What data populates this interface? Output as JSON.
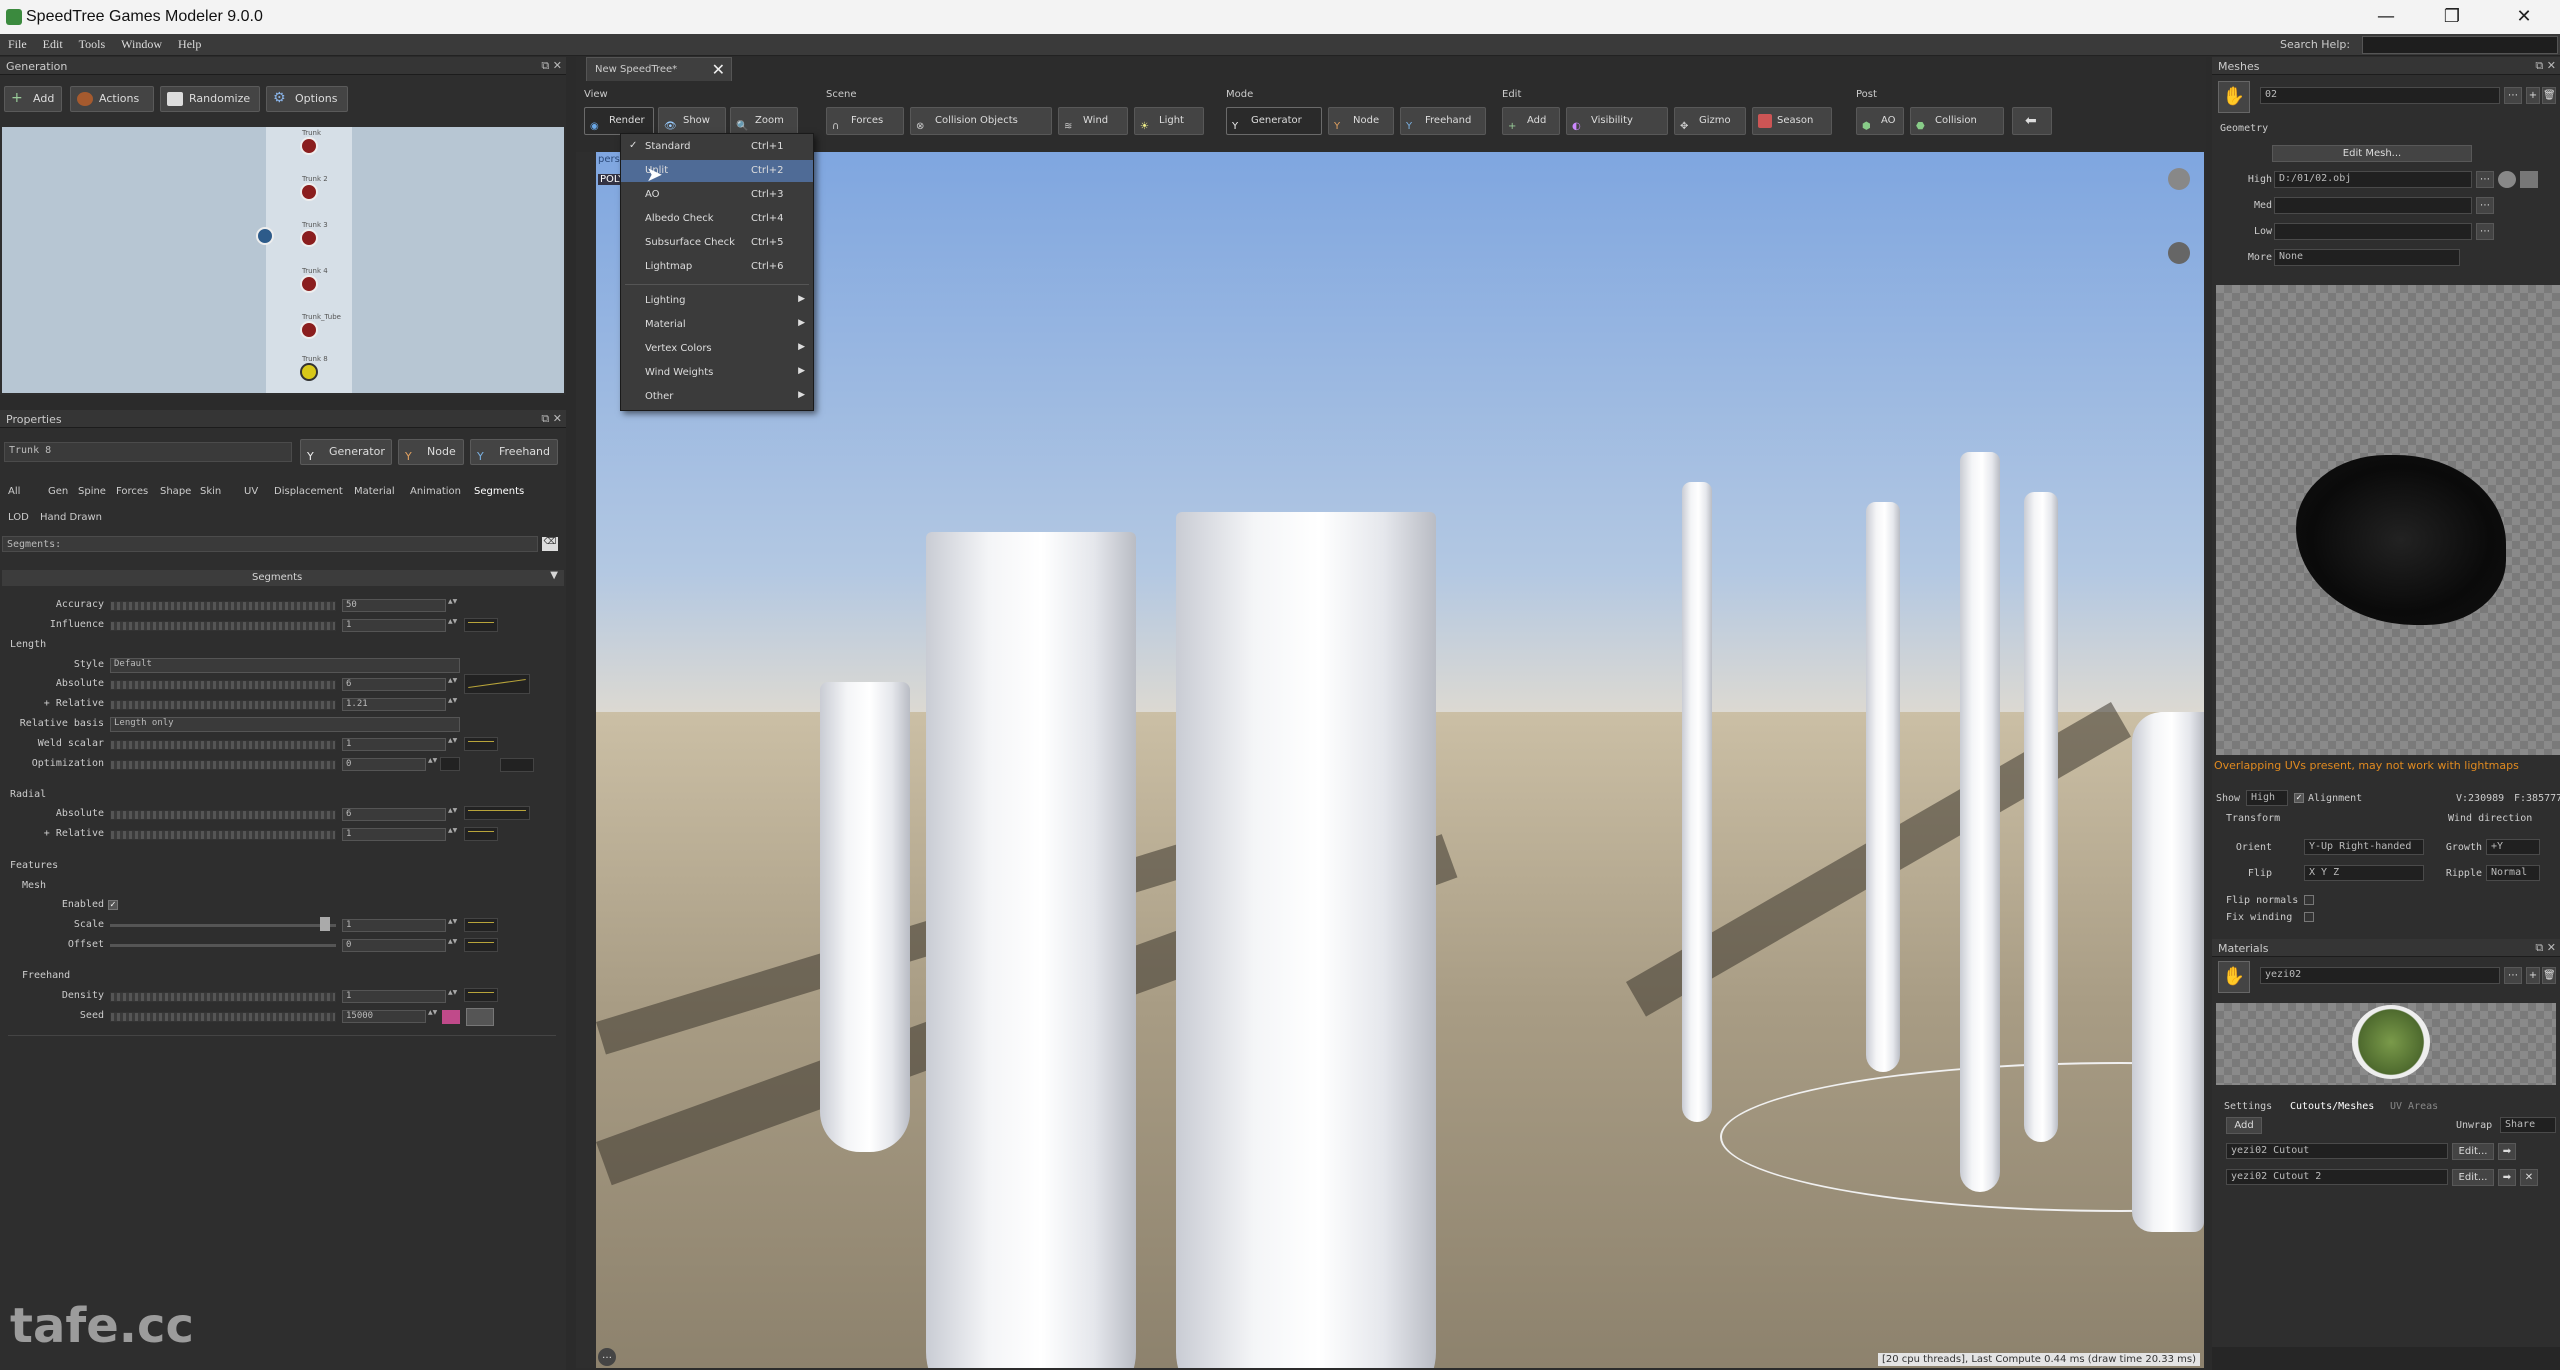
{
  "window": {
    "title": "SpeedTree Games Modeler 9.0.0",
    "minimize": "—",
    "maximize": "❐",
    "close": "✕"
  },
  "menu": {
    "items": [
      "File",
      "Edit",
      "Tools",
      "Window",
      "Help"
    ],
    "search_label": "Search Help:"
  },
  "generation": {
    "title": "Generation",
    "buttons": {
      "add": "Add",
      "actions": "Actions",
      "randomize": "Randomize",
      "options": "Options"
    },
    "nodes": [
      "Trunk",
      "Trunk 2",
      "Trunk 3",
      "Trunk 4",
      "Trunk_Tube",
      "Trunk 8"
    ]
  },
  "properties": {
    "title": "Properties",
    "name_value": "Trunk 8",
    "mode_buttons": {
      "generator": "Generator",
      "node": "Node",
      "freehand": "Freehand"
    },
    "tabs_row1": [
      "All",
      "Gen",
      "Spine",
      "Forces",
      "Shape",
      "Skin",
      "UV",
      "Displacement",
      "Material",
      "Animation",
      "Segments"
    ],
    "tabs_row2": [
      "LOD",
      "Hand Drawn"
    ],
    "filter_label": "Segments:",
    "section_title": "Segments",
    "rows": {
      "accuracy": {
        "label": "Accuracy",
        "value": "50"
      },
      "influence": {
        "label": "Influence",
        "value": "1"
      },
      "length_hdr": "Length",
      "style": {
        "label": "Style",
        "value": "Default"
      },
      "absolute": {
        "label": "Absolute",
        "value": "6"
      },
      "relative": {
        "label": "+ Relative",
        "value": "1.21"
      },
      "rel_basis": {
        "label": "Relative basis",
        "value": "Length only"
      },
      "weld": {
        "label": "Weld scalar",
        "value": "1"
      },
      "optimization": {
        "label": "Optimization",
        "value": "0"
      },
      "radial_hdr": "Radial",
      "r_absolute": {
        "label": "Absolute",
        "value": "6"
      },
      "r_relative": {
        "label": "+ Relative",
        "value": "1"
      },
      "features_hdr": "Features",
      "mesh_hdr": "Mesh",
      "enabled": {
        "label": "Enabled"
      },
      "scale": {
        "label": "Scale",
        "value": "1"
      },
      "offset": {
        "label": "Offset",
        "value": "0"
      },
      "freehand_hdr": "Freehand",
      "density": {
        "label": "Density",
        "value": "1"
      },
      "seed": {
        "label": "Seed",
        "value": "15000"
      }
    }
  },
  "center": {
    "doc_tab": "New SpeedTree*",
    "groups": {
      "view": "View",
      "scene": "Scene",
      "mode": "Mode",
      "edit": "Edit",
      "post": "Post"
    },
    "view_buttons": {
      "render": "Render",
      "show": "Show",
      "zoom": "Zoom"
    },
    "scene_buttons": {
      "forces": "Forces",
      "collision": "Collision Objects",
      "wind": "Wind",
      "light": "Light"
    },
    "mode_buttons": {
      "generator": "Generator",
      "node": "Node",
      "freehand": "Freehand"
    },
    "edit_buttons": {
      "add": "Add",
      "visibility": "Visibility",
      "gizmo": "Gizmo",
      "season": "Season"
    },
    "post_buttons": {
      "ao": "AO",
      "collision": "Collision"
    },
    "viewport_label_1": "perspe",
    "viewport_label_2": "POLYGO",
    "status": "[20 cpu threads], Last Compute 0.44 ms (draw time 20.33 ms)"
  },
  "render_menu": {
    "items": [
      {
        "label": "Standard",
        "shortcut": "Ctrl+1",
        "checked": true
      },
      {
        "label": "Unlit",
        "shortcut": "Ctrl+2",
        "highlighted": true
      },
      {
        "label": "AO",
        "shortcut": "Ctrl+3"
      },
      {
        "label": "Albedo Check",
        "shortcut": "Ctrl+4"
      },
      {
        "label": "Subsurface Check",
        "shortcut": "Ctrl+5"
      },
      {
        "label": "Lightmap",
        "shortcut": "Ctrl+6"
      }
    ],
    "submenus": [
      "Lighting",
      "Material",
      "Vertex Colors",
      "Wind Weights",
      "Other"
    ]
  },
  "meshes": {
    "title": "Meshes",
    "name": "02",
    "geometry_hdr": "Geometry",
    "edit_mesh": "Edit Mesh...",
    "high": {
      "label": "High",
      "value": "D:/01/02.obj"
    },
    "med": {
      "label": "Med",
      "value": ""
    },
    "low": {
      "label": "Low",
      "value": ""
    },
    "more": {
      "label": "More",
      "value": "None"
    },
    "warning": "Overlapping UVs present, may not work with lightmaps",
    "show_label": "Show",
    "show_value": "High",
    "alignment_label": "Alignment",
    "verts": "V:230989",
    "faces": "F:385777",
    "transform_hdr": "Transform",
    "wind_hdr": "Wind direction",
    "orient": {
      "label": "Orient",
      "value": "Y-Up Right-handed"
    },
    "flip": {
      "label": "Flip",
      "value": "X Y Z"
    },
    "growth": {
      "label": "Growth",
      "value": "+Y"
    },
    "ripple": {
      "label": "Ripple",
      "value": "Normal"
    },
    "flip_normals": "Flip normals",
    "fix_winding": "Fix winding"
  },
  "materials": {
    "title": "Materials",
    "name": "yezi02",
    "tabs": [
      "Settings",
      "Cutouts/Meshes",
      "UV Areas"
    ],
    "add": "Add",
    "unwrap_label": "Unwrap",
    "unwrap_value": "Share",
    "rows": [
      "yezi02 Cutout",
      "yezi02 Cutout 2"
    ],
    "edit": "Edit..."
  },
  "watermark": "tafe.cc"
}
